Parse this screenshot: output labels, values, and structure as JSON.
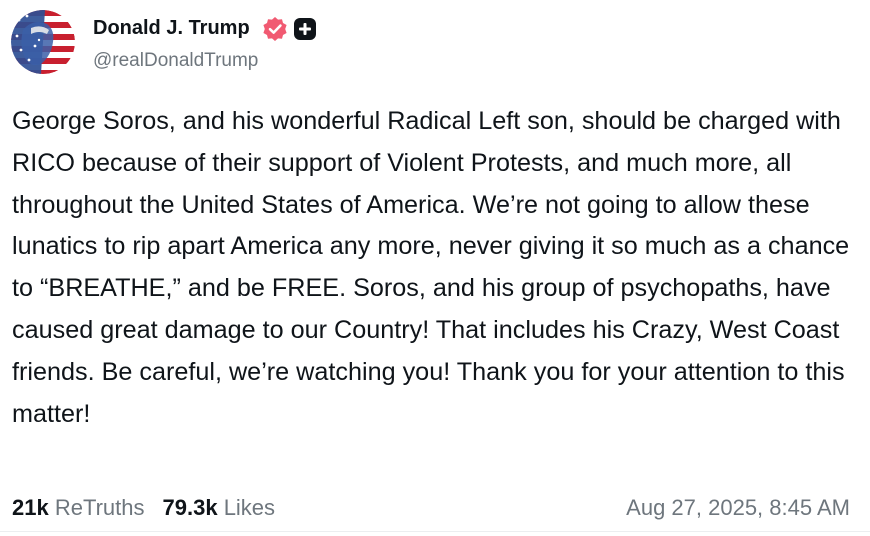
{
  "author": {
    "display_name": "Donald J. Trump",
    "handle": "@realDonaldTrump",
    "avatar_icon": "flag-portrait-avatar",
    "verified_icon": "verified-badge-icon",
    "verified_color": "#f15a72",
    "plus_icon": "plus-badge-icon"
  },
  "post": {
    "text": "George Soros, and his wonderful Radical Left son, should be charged with RICO because of their support of Violent Protests, and much more, all throughout the United States of America. We’re not going to allow these lunatics to rip apart America any more, never giving it so much as a chance to “BREATHE,” and be FREE. Soros, and his group of psychopaths, have caused great damage to our Country! That includes his Crazy, West Coast friends. Be careful, we’re watching you! Thank you for your attention to this matter!",
    "retruths_count": "21k",
    "retruths_label": "ReTruths",
    "likes_count": "79.3k",
    "likes_label": "Likes",
    "timestamp": "Aug 27, 2025, 8:45 AM"
  },
  "colors": {
    "text": "#0f1419",
    "muted": "#6e767d"
  }
}
